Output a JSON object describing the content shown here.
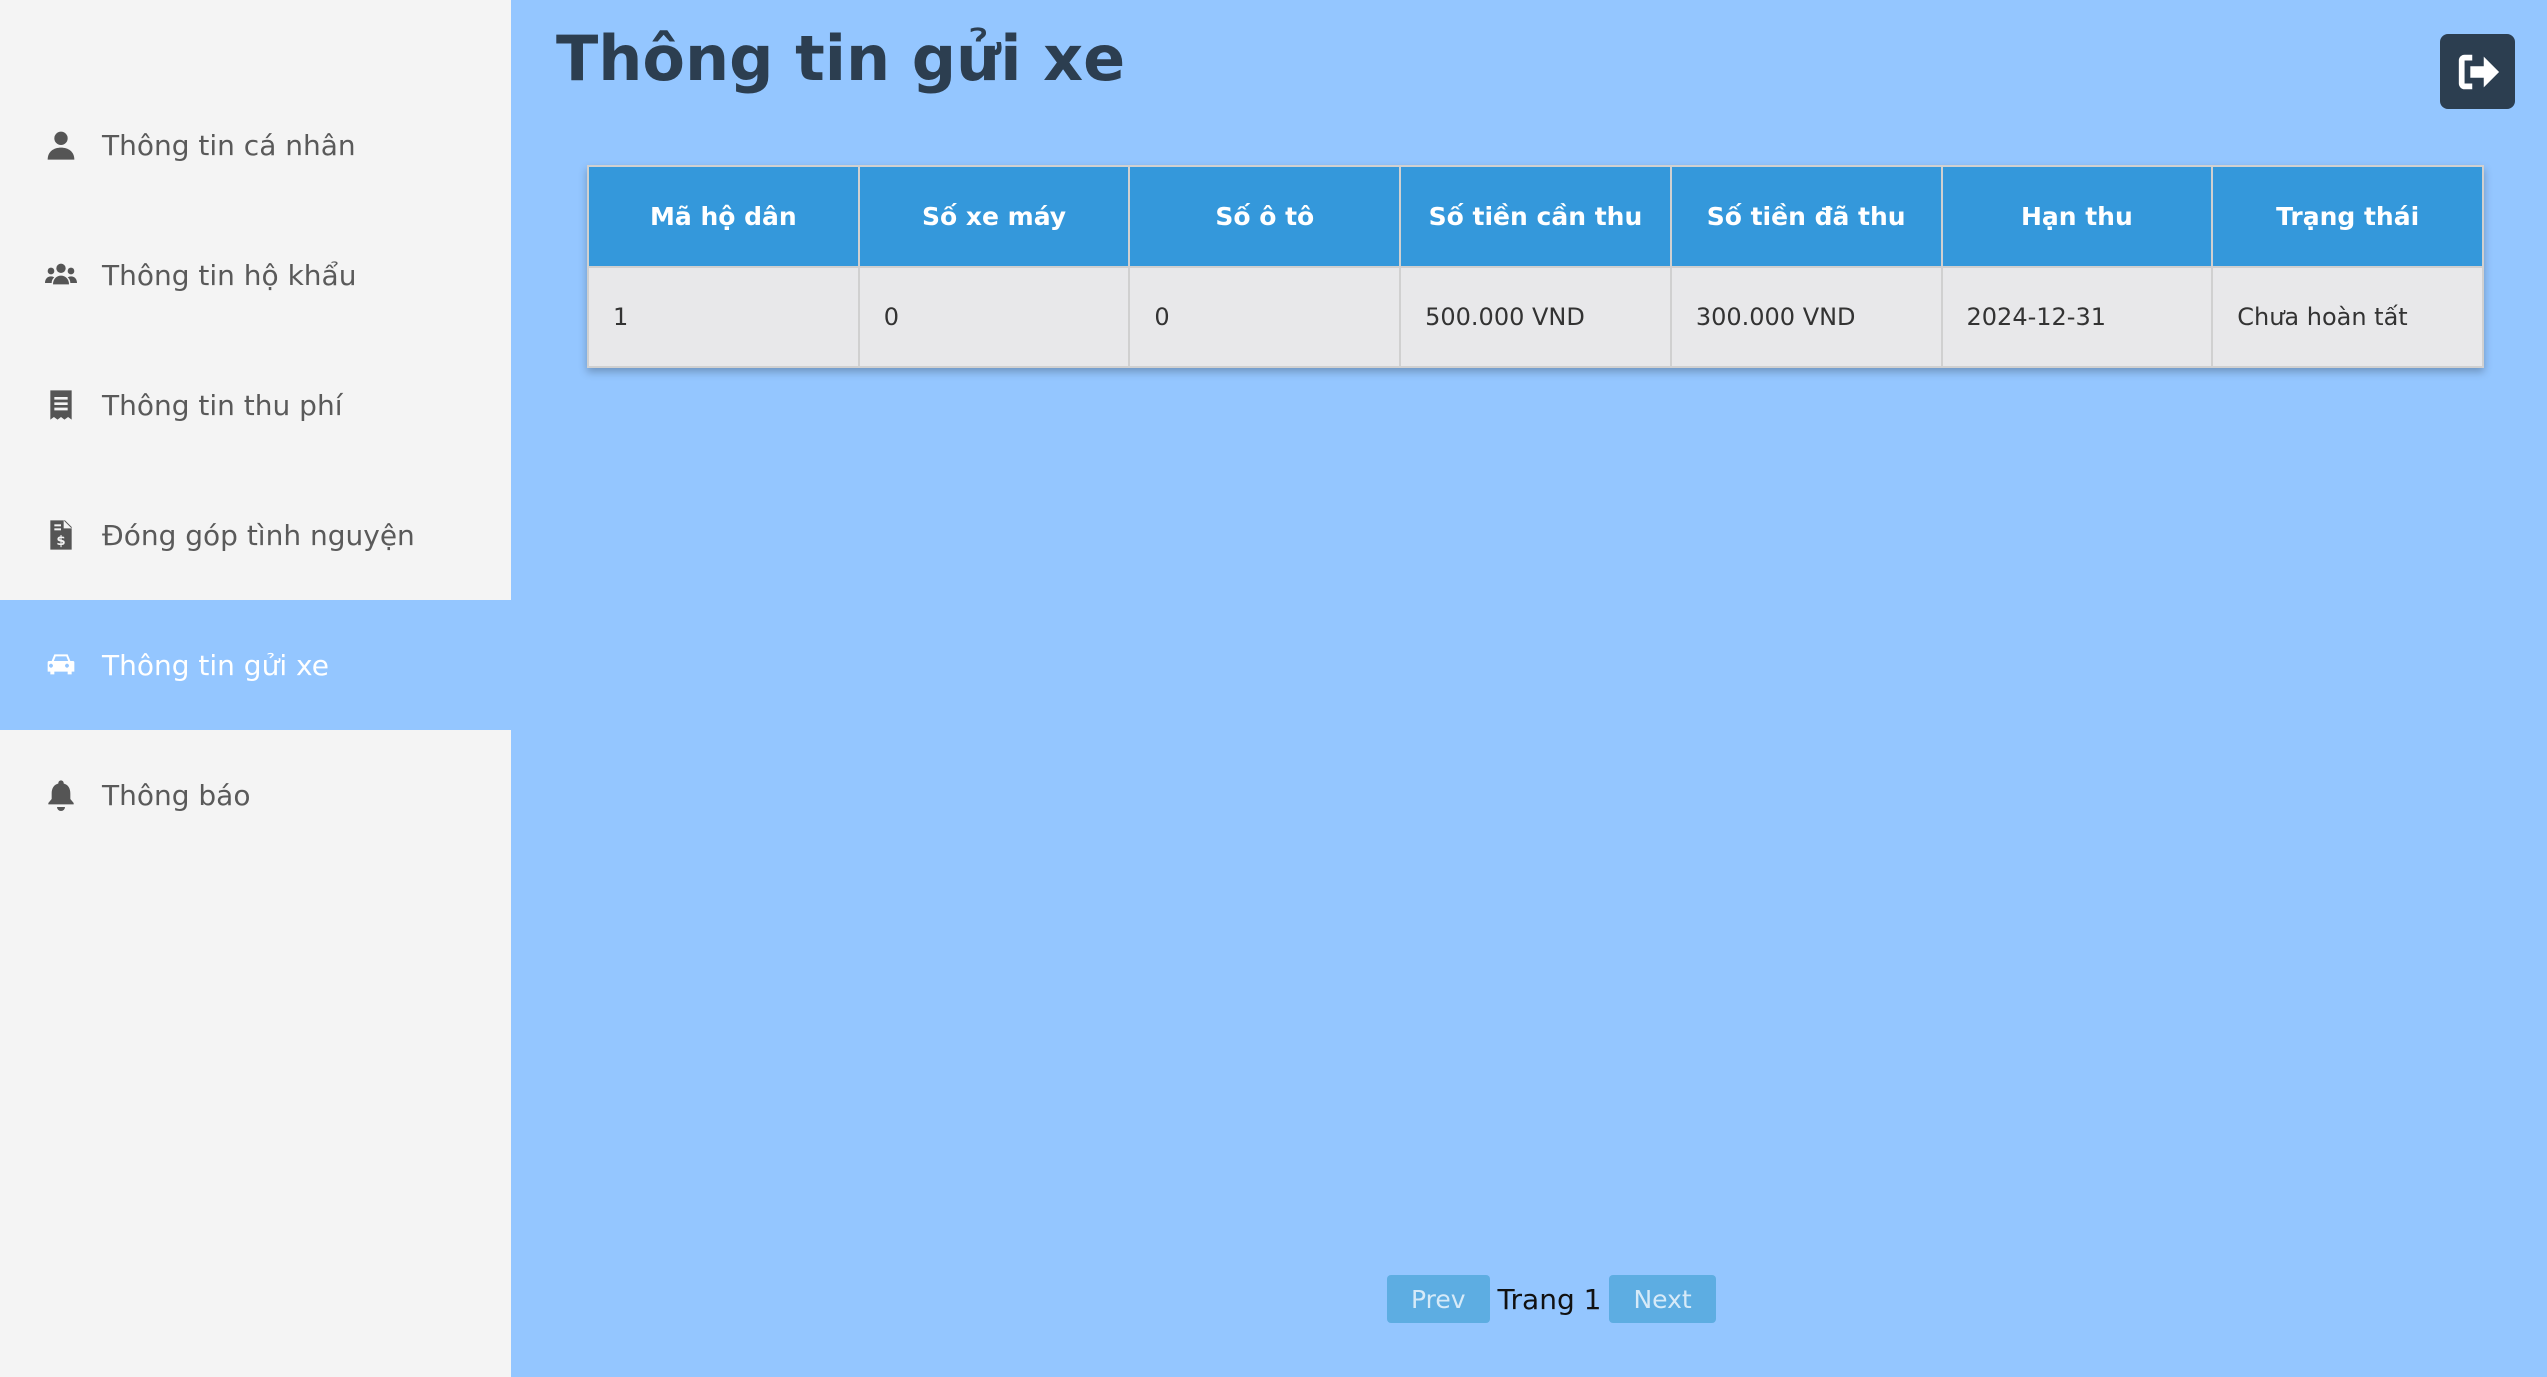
{
  "sidebar": {
    "items": [
      {
        "label": "Thông tin cá nhân",
        "icon": "user-icon"
      },
      {
        "label": "Thông tin hộ khẩu",
        "icon": "users-icon"
      },
      {
        "label": "Thông tin thu phí",
        "icon": "receipt-icon"
      },
      {
        "label": "Đóng góp tình nguyện",
        "icon": "invoice-dollar-icon"
      },
      {
        "label": "Thông tin gửi xe",
        "icon": "car-icon",
        "active": true
      },
      {
        "label": "Thông báo",
        "icon": "bell-icon"
      }
    ]
  },
  "header": {
    "title": "Thông tin gửi xe",
    "logout_icon": "sign-out-icon"
  },
  "table": {
    "columns": [
      "Mã hộ dân",
      "Số xe máy",
      "Số ô tô",
      "Số tiền cần thu",
      "Số tiền đã thu",
      "Hạn thu",
      "Trạng thái"
    ],
    "rows": [
      [
        "1",
        "0",
        "0",
        "500.000 VND",
        "300.000 VND",
        "2024-12-31",
        "Chưa hoàn tất"
      ]
    ]
  },
  "pagination": {
    "prev_label": "Prev",
    "page_text": "Trang 1",
    "next_label": "Next"
  },
  "colors": {
    "sidebar_bg": "#f4f4f4",
    "main_bg": "#94c6ff",
    "header_bg": "#3498db",
    "title_color": "#2c3e50"
  }
}
